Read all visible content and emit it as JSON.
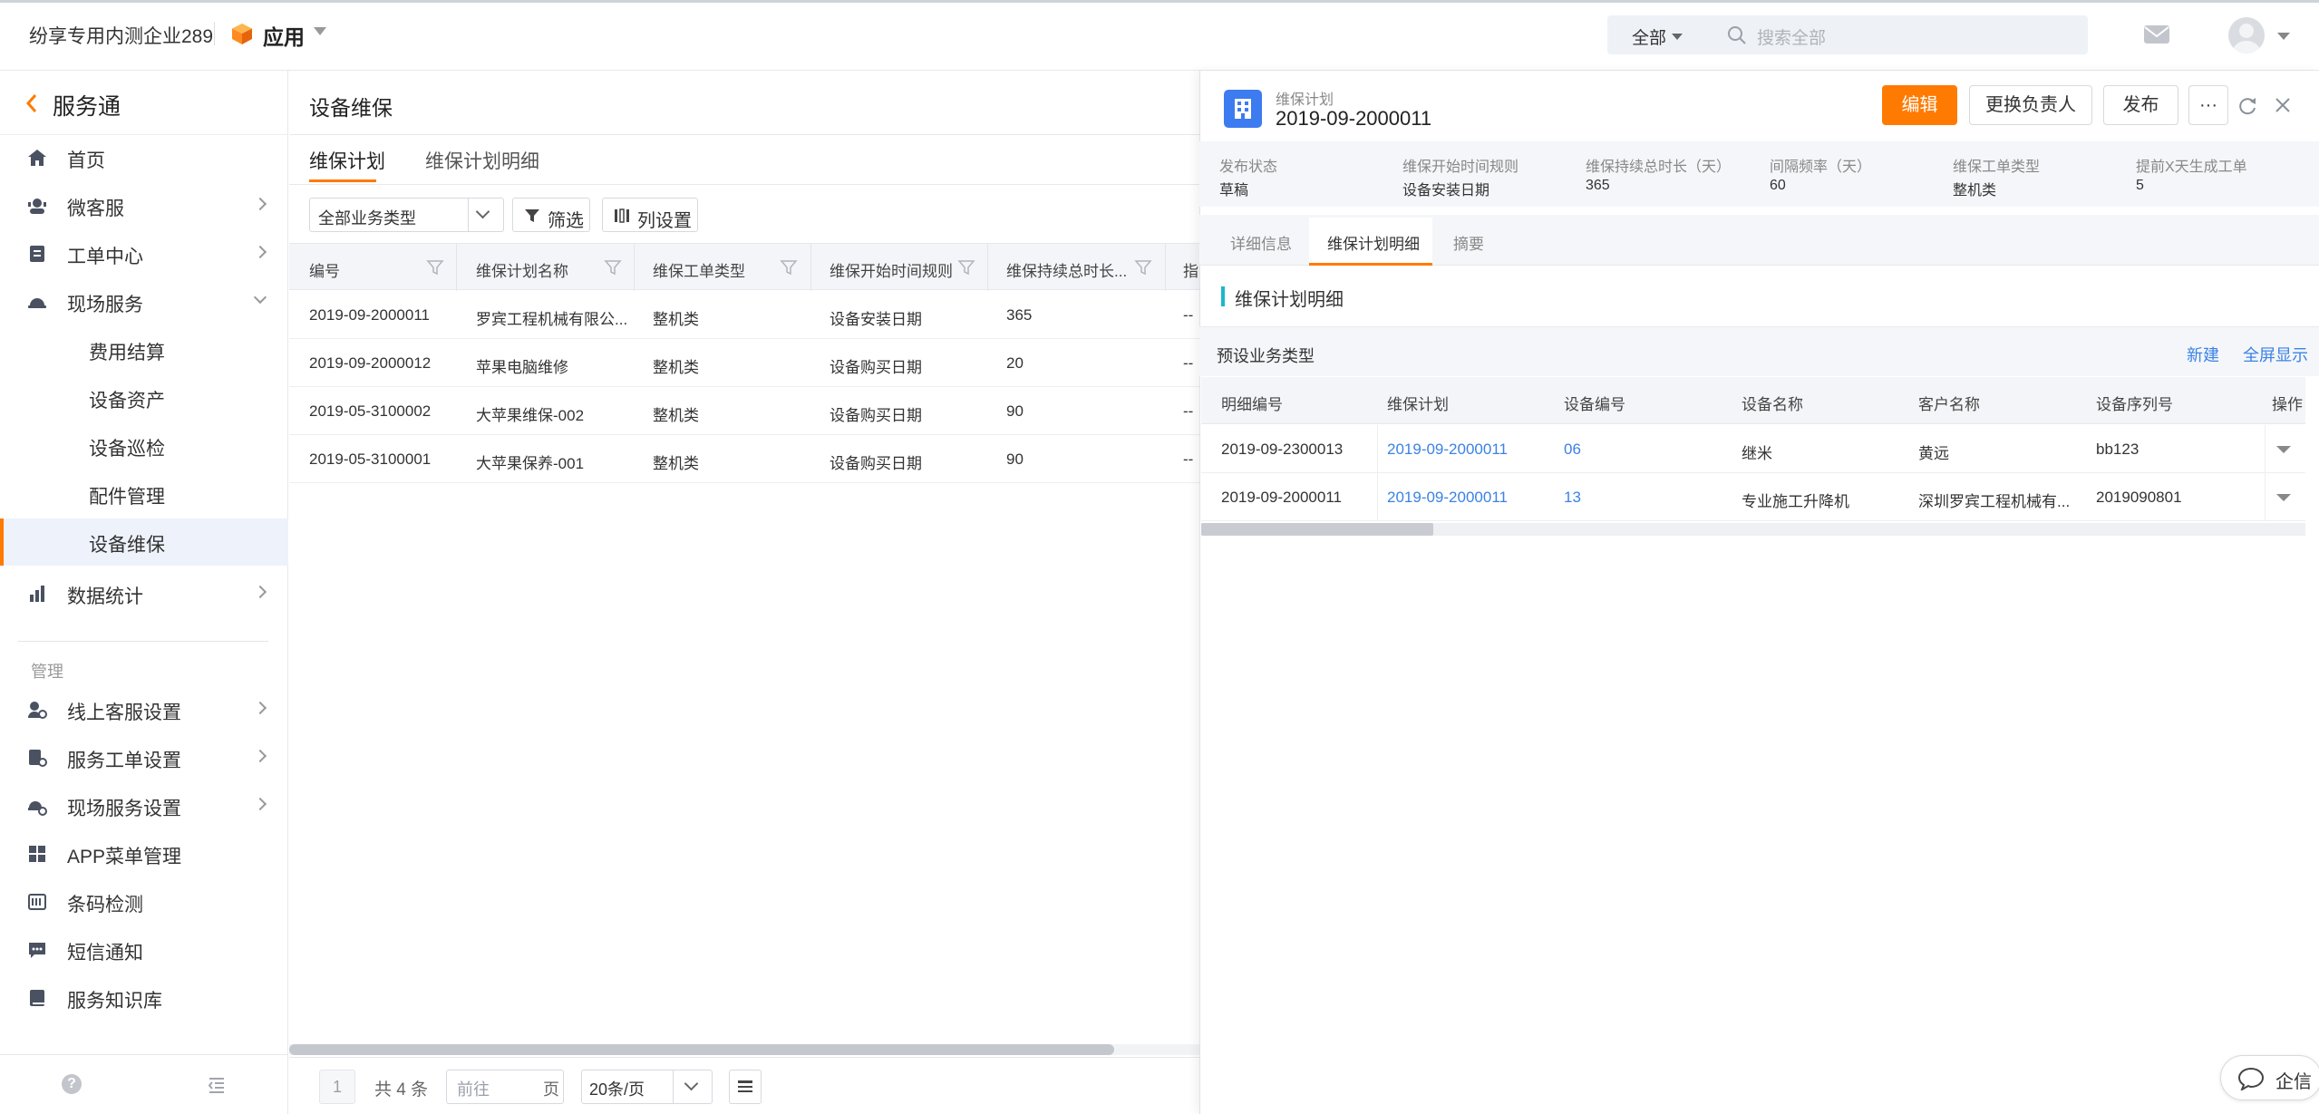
{
  "topbar": {
    "company": "纷享专用内测企业289",
    "app_label": "应用",
    "scope_label": "全部",
    "search_placeholder": "搜索全部"
  },
  "sidebar": {
    "title": "服务通",
    "items": [
      {
        "label": "首页"
      },
      {
        "label": "微客服"
      },
      {
        "label": "工单中心"
      },
      {
        "label": "现场服务"
      },
      {
        "label": "数据统计"
      }
    ],
    "sub_items": [
      {
        "label": "费用结算"
      },
      {
        "label": "设备资产"
      },
      {
        "label": "设备巡检"
      },
      {
        "label": "配件管理"
      },
      {
        "label": "设备维保"
      }
    ],
    "section_label": "管理",
    "manage_items": [
      {
        "label": "线上客服设置"
      },
      {
        "label": "服务工单设置"
      },
      {
        "label": "现场服务设置"
      },
      {
        "label": "APP菜单管理"
      },
      {
        "label": "条码检测"
      },
      {
        "label": "短信通知"
      },
      {
        "label": "服务知识库"
      }
    ]
  },
  "main": {
    "title": "设备维保",
    "tabs": [
      {
        "label": "维保计划"
      },
      {
        "label": "维保计划明细"
      }
    ],
    "filter_select": "全部业务类型",
    "filter_button": "筛选",
    "columns_button": "列设置",
    "columns": [
      "编号",
      "维保计划名称",
      "维保工单类型",
      "维保开始时间规则",
      "维保持续总时长...",
      "指"
    ],
    "rows": [
      {
        "id": "2019-09-2000011",
        "name": "罗宾工程机械有限公...",
        "type": "整机类",
        "rule": "设备安装日期",
        "duration": "365",
        "extra": "--"
      },
      {
        "id": "2019-09-2000012",
        "name": "苹果电脑维修",
        "type": "整机类",
        "rule": "设备购买日期",
        "duration": "20",
        "extra": "--"
      },
      {
        "id": "2019-05-3100002",
        "name": "大苹果维保-002",
        "type": "整机类",
        "rule": "设备购买日期",
        "duration": "90",
        "extra": "--"
      },
      {
        "id": "2019-05-3100001",
        "name": "大苹果保养-001",
        "type": "整机类",
        "rule": "设备购买日期",
        "duration": "90",
        "extra": "--"
      }
    ],
    "pager": {
      "current": "1",
      "total": "共 4 条",
      "goto_placeholder": "前往",
      "goto_suffix": "页",
      "page_size": "20条/页"
    }
  },
  "panel": {
    "object_type": "维保计划",
    "title": "2019-09-2000011",
    "buttons": {
      "edit": "编辑",
      "change_owner": "更换负责人",
      "publish": "发布",
      "more": "···"
    },
    "summary": [
      {
        "label": "发布状态",
        "value": "草稿"
      },
      {
        "label": "维保开始时间规则",
        "value": "设备安装日期"
      },
      {
        "label": "维保持续总时长（天）",
        "value": "365"
      },
      {
        "label": "间隔频率（天）",
        "value": "60"
      },
      {
        "label": "维保工单类型",
        "value": "整机类"
      },
      {
        "label": "提前X天生成工单",
        "value": "5"
      }
    ],
    "tabs": [
      {
        "label": "详细信息"
      },
      {
        "label": "维保计划明细"
      },
      {
        "label": "摘要"
      }
    ],
    "section_title": "维保计划明细",
    "sub_title": "预设业务类型",
    "link_new": "新建",
    "link_full": "全屏显示",
    "columns": [
      "明细编号",
      "维保计划",
      "设备编号",
      "设备名称",
      "客户名称",
      "设备序列号",
      "操作"
    ],
    "rows": [
      {
        "id": "2019-09-2300013",
        "plan": "2019-09-2000011",
        "device_no": "06",
        "device_name": "继米",
        "customer": "黄远",
        "serial": "bb123"
      },
      {
        "id": "2019-09-2000011",
        "plan": "2019-09-2000011",
        "device_no": "13",
        "device_name": "专业施工升降机",
        "customer": "深圳罗宾工程机械有...",
        "serial": "2019090801"
      }
    ]
  },
  "chat": {
    "label": "企信"
  },
  "colors": {
    "accent": "#ff7a00",
    "link": "#3b82e6",
    "brand_blue": "#3d7bf0"
  }
}
